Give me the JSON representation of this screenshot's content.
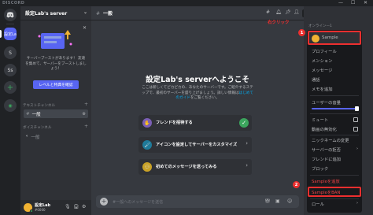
{
  "app": {
    "brand": "DISCORD"
  },
  "window": {
    "minimize": "—",
    "maximize": "☐",
    "close": "✕"
  },
  "rail": {
    "active_server": "設定La",
    "server_1": "S",
    "server_2": "Ss",
    "add": "+",
    "explore": "◉"
  },
  "sidebar": {
    "server_name": "設定Lab's server",
    "boost": {
      "text": "サーバーブーストがあります！ 友達を集めて、サーバーをブーストしましょう！",
      "button": "レベルと特典を確認"
    },
    "text_category": "テキストチャンネル",
    "text_channel": "一般",
    "voice_category": "ボイスチャンネル",
    "voice_channel": "一般"
  },
  "userbar": {
    "name": "設定Lab",
    "tag": "#0000"
  },
  "main": {
    "channel": "一般",
    "search_placeholder": "検索",
    "welcome_title": "設定Lab's serverへようこそ",
    "welcome_sub": "ここは新しくてピカピカの、あなたのサーバーです。ご紹介するステップで、最初のサーバーを盛り上げましょう。詳しい情報は",
    "welcome_link": "はじめてのガイド",
    "welcome_end": "をご覧ください。",
    "tasks": [
      {
        "label": "フレンドを招待する",
        "done": true
      },
      {
        "label": "アイコンを設定してサーバーをカスタマイズ",
        "done": false
      },
      {
        "label": "初めてのメッセージを送ってみる",
        "done": false
      }
    ],
    "message_placeholder": "#一般へのメッセージを送信"
  },
  "members": {
    "online_header": "オンライン—1"
  },
  "context_menu": {
    "user": "Sample",
    "items": {
      "profile": "プロフィール",
      "mention": "メンション",
      "message": "メッセージ",
      "call": "通話",
      "add_note": "メモを追加",
      "user_volume": "ユーザーの音量",
      "mute": "ミュート",
      "disable_video": "動画の無効化",
      "change_nickname": "ニックネームの変更",
      "server_mute": "サーバーの拒否",
      "add_friend": "フレンドに追加",
      "block": "ブロック",
      "kick": "Sampleを追放",
      "ban": "SampleをBAN",
      "roles": "ロール"
    }
  },
  "annotations": {
    "step1": "1",
    "step1_label": "右クリック",
    "step2": "2"
  },
  "colors": {
    "accent": "#5865f2",
    "annotation": "#ed2f2f",
    "online": "#3ba55d",
    "danger": "#ed4245"
  }
}
